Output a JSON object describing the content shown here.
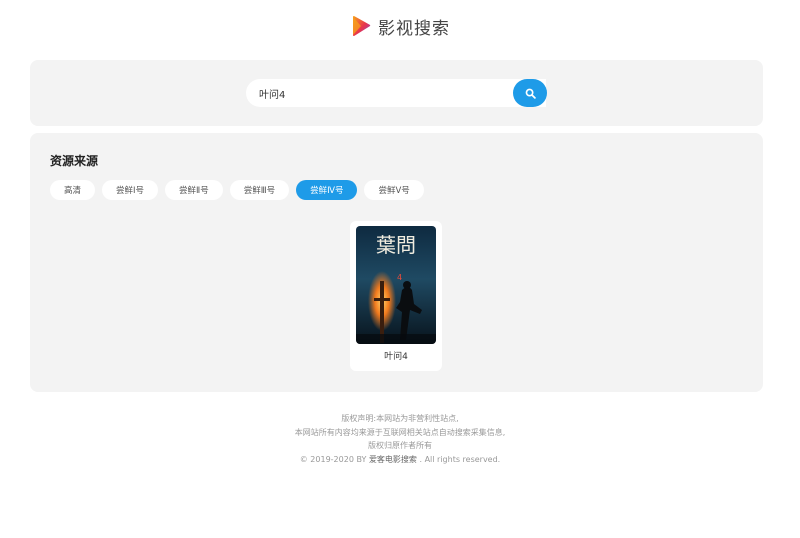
{
  "header": {
    "title": "影视搜索",
    "logo_icon": "play-triangle-logo-icon",
    "brand_colors": [
      "#e8344b",
      "#f7a21b",
      "#8a3fd1"
    ]
  },
  "search": {
    "value": "叶问4",
    "button_icon": "search-icon",
    "button_color": "#1e9be8"
  },
  "sources": {
    "title": "资源来源",
    "tabs": [
      {
        "label": "高清",
        "active": false
      },
      {
        "label": "尝鲜Ⅰ号",
        "active": false
      },
      {
        "label": "尝鲜Ⅱ号",
        "active": false
      },
      {
        "label": "尝鲜Ⅲ号",
        "active": false
      },
      {
        "label": "尝鲜Ⅳ号",
        "active": true
      },
      {
        "label": "尝鲜Ⅴ号",
        "active": false
      }
    ]
  },
  "results": [
    {
      "title": "叶问4",
      "poster_text": "葉問",
      "poster_number": "4"
    }
  ],
  "footer": {
    "line1": "版权声明:本网站为非营利性站点,",
    "line2": "本网站所有内容均来源于互联网相关站点自动搜索采集信息,",
    "line3": "版权归原作者所有",
    "copyright_prefix": "© 2019-2020 BY ",
    "site_link": "爱客电影搜索",
    "copyright_suffix": " . All rights reserved."
  }
}
